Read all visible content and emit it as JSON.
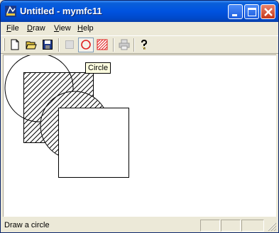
{
  "window": {
    "title": "Untitled - mymfc11"
  },
  "menu": [
    {
      "label": "File",
      "key": "F",
      "rest": "ile"
    },
    {
      "label": "Draw",
      "key": "D",
      "rest": "raw"
    },
    {
      "label": "View",
      "key": "V",
      "rest": "iew"
    },
    {
      "label": "Help",
      "key": "H",
      "rest": "elp"
    }
  ],
  "toolbar": {
    "tools": [
      "new-icon",
      "open-icon",
      "save-icon",
      "rectangle-icon",
      "circle-icon",
      "pattern-icon",
      "print-icon",
      "help-icon"
    ],
    "pressed_tool": "circle-icon"
  },
  "tooltip": {
    "text": "Circle"
  },
  "status": {
    "text": "Draw a circle"
  },
  "colors": {
    "title_blue": "#0054e3",
    "close_red": "#e0492a",
    "face": "#ece9d8",
    "circle_red": "#e02020"
  }
}
